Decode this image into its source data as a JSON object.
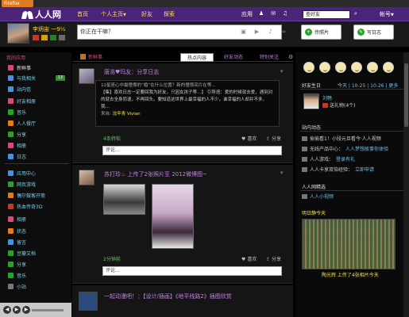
{
  "browser": {
    "menu_button": "Firefox"
  },
  "nav": {
    "brand": "人人网",
    "links": [
      "首页",
      "个人主页",
      "好友",
      "探索"
    ],
    "right_links": [
      "应用",
      "游戏"
    ],
    "search_value": "查好友",
    "account": "帐号"
  },
  "profile": {
    "name": "李炳宙 一9½"
  },
  "status": {
    "placeholder": "你正在干嘛？",
    "buttons": [
      "传照片",
      "写日志"
    ]
  },
  "sidebar": {
    "heading": "我的应用",
    "items": [
      {
        "label": "新鲜事",
        "icon": "feed-icon",
        "color": "#d04c7c"
      },
      {
        "label": "与我相关",
        "icon": "mention-icon",
        "color": "#4a90d9",
        "badge": "13"
      },
      {
        "label": "站内信",
        "icon": "mail-icon",
        "color": "#4a90d9"
      },
      {
        "label": "好友相册",
        "icon": "photo-icon",
        "color": "#d04c7c"
      },
      {
        "label": "音乐",
        "icon": "music-icon",
        "color": "#2f9e2f"
      },
      {
        "label": "人人餐厅",
        "icon": "restaurant-icon",
        "color": "#e07b1f"
      },
      {
        "label": "分享",
        "icon": "share-icon",
        "color": "#2f9e2f"
      },
      {
        "label": "相册",
        "icon": "album-icon",
        "color": "#d04c7c"
      },
      {
        "label": "日志",
        "icon": "blog-icon",
        "color": "#4a90d9"
      },
      {
        "label": "应用中心",
        "icon": "apps-icon",
        "color": "#4a90d9"
      },
      {
        "label": "网页游戏",
        "icon": "game-icon",
        "color": "#2f9e2f"
      },
      {
        "label": "偶尔做客开斋",
        "icon": "guest-icon",
        "color": "#e07b1f"
      },
      {
        "label": "热血传奇3D",
        "icon": "legend-icon",
        "color": "#c0392b"
      },
      {
        "label": "相册",
        "icon": "album2-icon",
        "color": "#d04c7c"
      },
      {
        "label": "状态",
        "icon": "status-icon",
        "color": "#e07b1f"
      },
      {
        "label": "留言",
        "icon": "guestbook-icon",
        "color": "#4a90d9"
      },
      {
        "label": "豆瓣文档",
        "icon": "doc-icon",
        "color": "#2f9e2f"
      },
      {
        "label": "分享",
        "icon": "share2-icon",
        "color": "#2f9e2f"
      },
      {
        "label": "音乐",
        "icon": "music2-icon",
        "color": "#2f9e2f"
      },
      {
        "label": "小站",
        "icon": "site-icon",
        "color": "#777777"
      }
    ]
  },
  "feed": {
    "label": "新鲜事",
    "tabs": [
      "热点内容",
      "好友动态",
      "特别关注"
    ],
    "active_tab": 0,
    "posts": [
      {
        "author": "唐浩♥玛友",
        "action": "：分享日志",
        "quote_title": "12星座心中最憧憬的“婚”在什么位置？新的憧憬亮片在等…",
        "quote_body": "【集】喜欢日志一定要回我为好友，只因女孩子等…】   引导语：爱的时候就去爱，遇到对的就去全身而退，不再回头。要知道这世界上最幸福的人不少，谁幸福的人却并不多，我…",
        "source_label": "来自:",
        "source_name": "沈辛青 Vivian",
        "reads": "4条转帖",
        "like": "喜欢",
        "share": "分享",
        "comment_placeholder": "评论…"
      },
      {
        "author": "苏打珍",
        "action": "上传了2张照片至 2012微博图~",
        "reads": "2分钟前",
        "like": "喜欢",
        "share": "分享",
        "comment_placeholder": "评论…"
      },
      {
        "author": "一起动漫吧！",
        "action": "：【设计/插画】《地平线路2》插图欣赏"
      }
    ]
  },
  "right": {
    "birthday_title": "好友生日",
    "birthday_links": [
      "今天",
      "10-25",
      "10-26",
      "更多"
    ],
    "birthday_friend": "刘畅",
    "birthday_gift": "送礼物(4个)",
    "site_title": "站内动态",
    "site_items": [
      {
        "text": "偷偷看1！小段元旦看今·人人视频",
        "link": ""
      },
      {
        "text": "无线产品中心：",
        "link": "人人梦想故事你体验"
      },
      {
        "text": "人人游戏：",
        "link": "登录有礼"
      },
      {
        "text": "人人卡享双倍经验：",
        "link": "立即申请"
      }
    ],
    "app_title": "人人网精选",
    "app_item": "人人小视频",
    "photo_title": "明日静今天",
    "photo_caption": "陶光辉 上传了4张相片今天"
  },
  "player": {
    "controls": [
      "prev",
      "play",
      "next"
    ]
  }
}
